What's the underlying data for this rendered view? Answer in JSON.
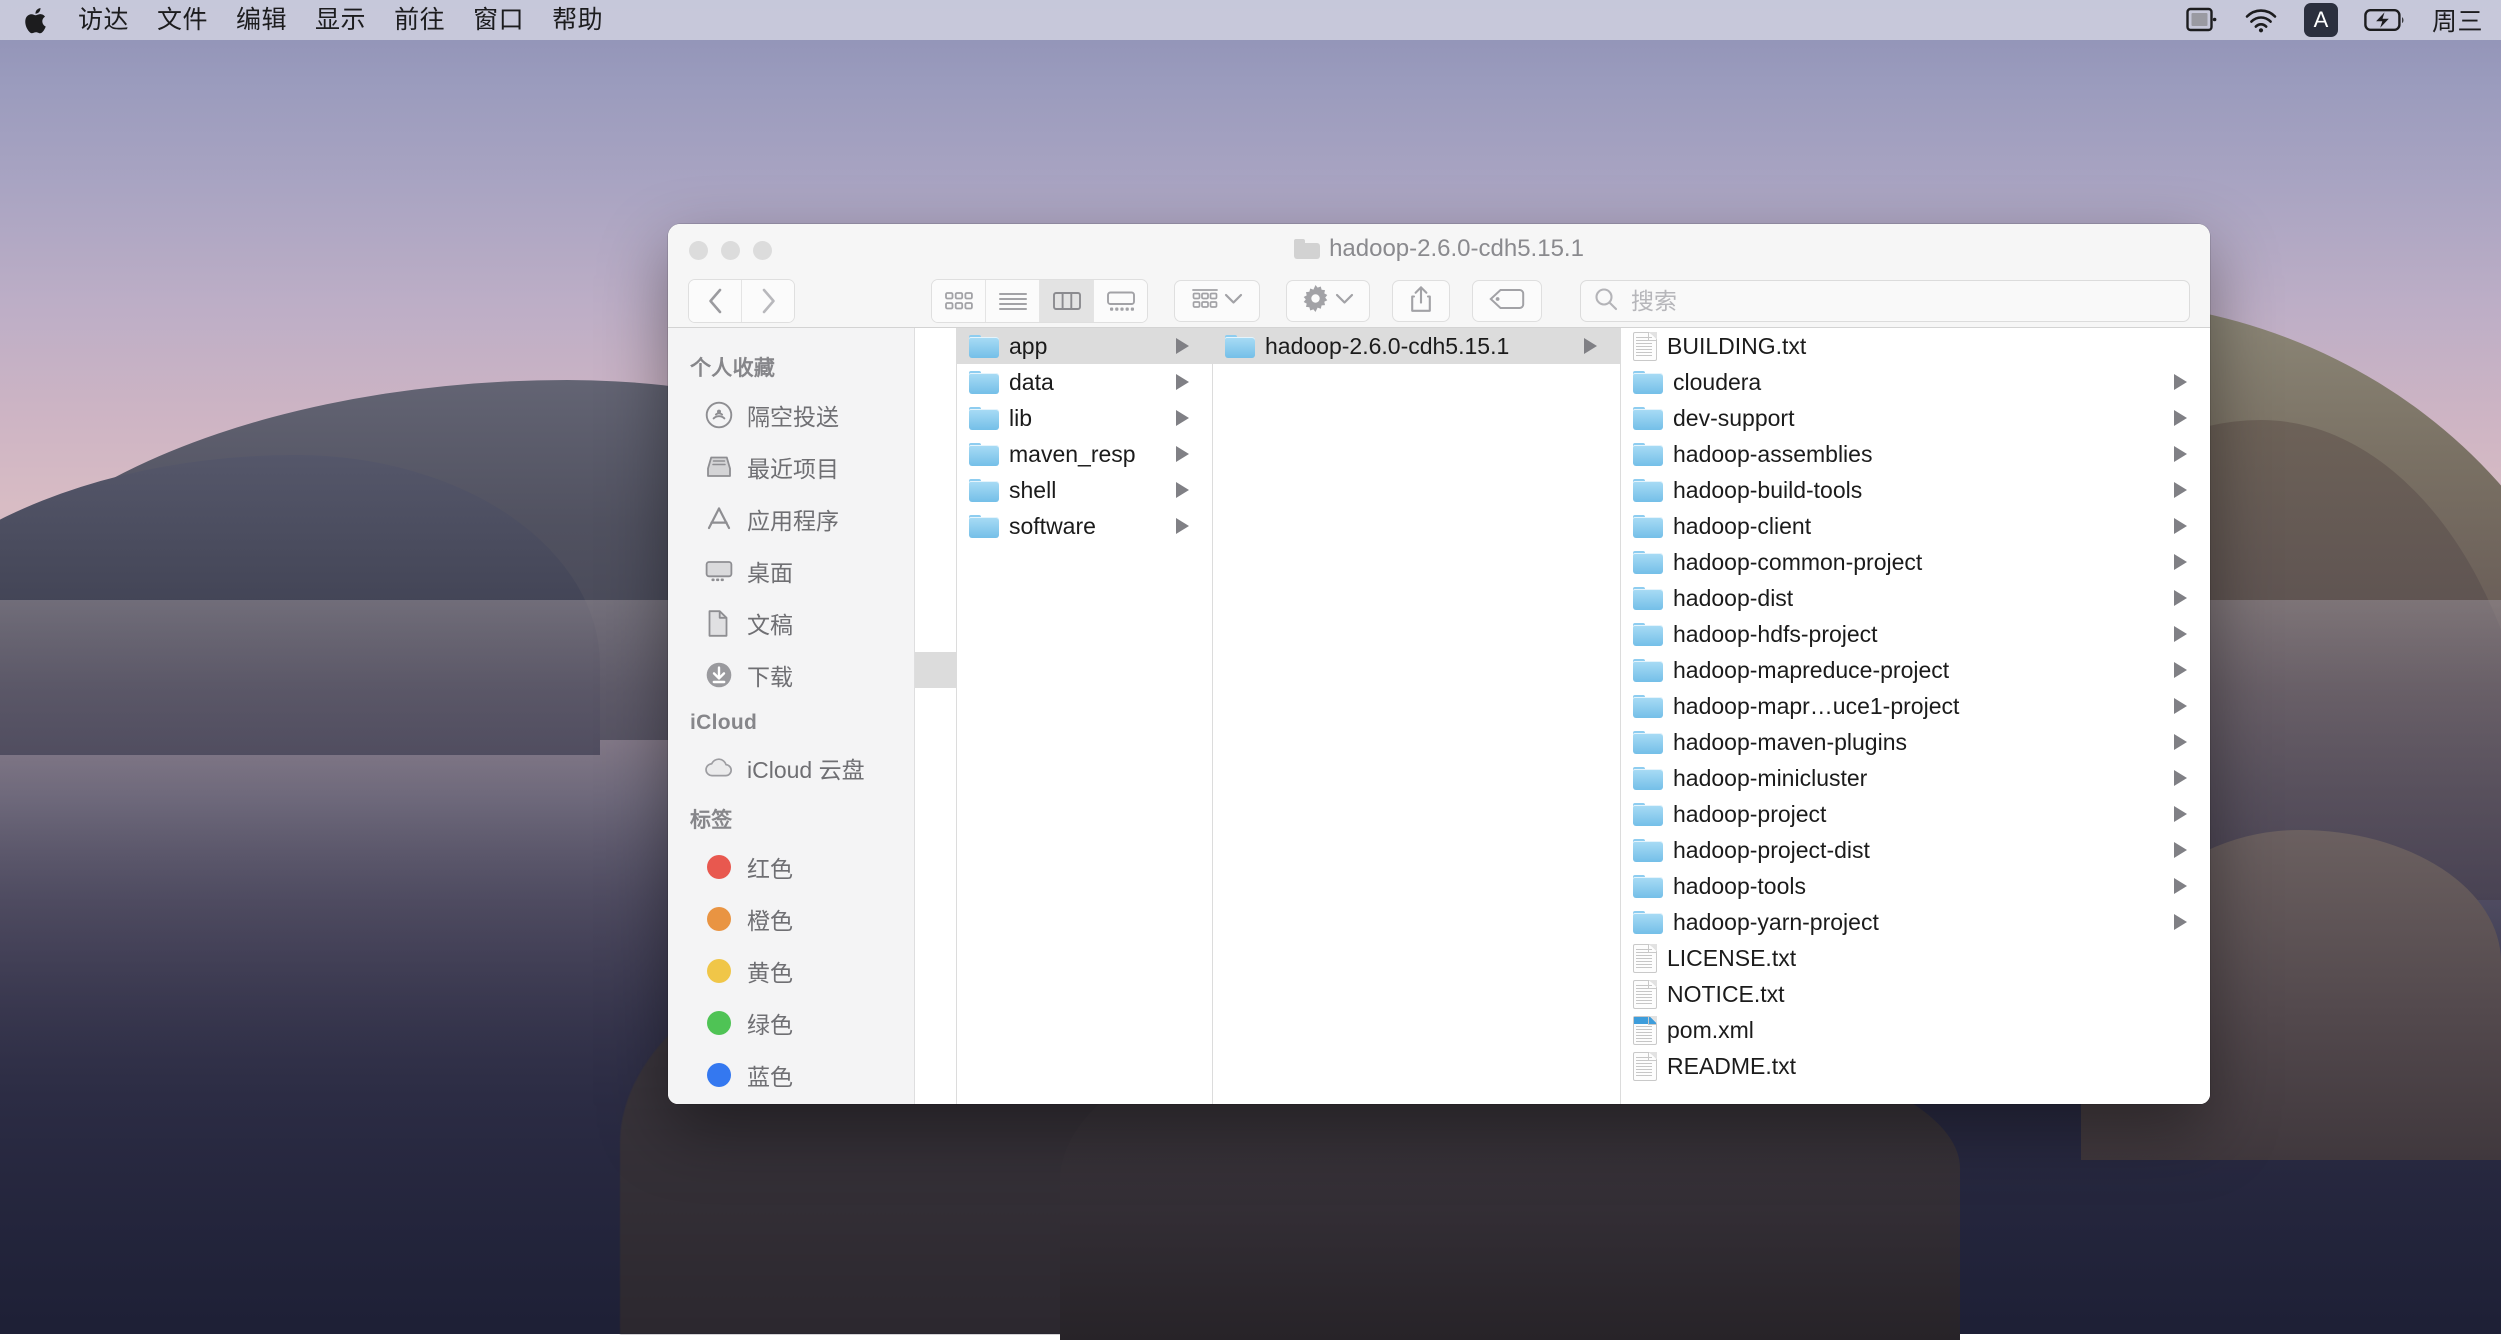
{
  "menubar": {
    "apple_icon": "apple-logo-icon",
    "items": [
      "访达",
      "文件",
      "编辑",
      "显示",
      "前往",
      "窗口",
      "帮助"
    ],
    "status_icons": [
      "screen-mirroring-icon",
      "wifi-icon",
      "input-source-badge",
      "battery-charging-icon"
    ],
    "input_source_label": "A",
    "clock": "周三"
  },
  "window": {
    "title": "hadoop-2.6.0-cdh5.15.1",
    "title_icon": "folder-icon",
    "traffic_lights": [
      "close-button",
      "minimize-button",
      "zoom-button"
    ]
  },
  "toolbar": {
    "back_icon": "chevron-left-icon",
    "forward_icon": "chevron-right-icon",
    "view_modes": [
      {
        "name": "icon-view",
        "icon": "grid-icon",
        "active": false
      },
      {
        "name": "list-view",
        "icon": "list-icon",
        "active": false
      },
      {
        "name": "column-view",
        "icon": "columns-icon",
        "active": true
      },
      {
        "name": "gallery-view",
        "icon": "gallery-icon",
        "active": false
      }
    ],
    "arrange_icon": "arrange-icon",
    "arrange_chevron": "chevron-down-icon",
    "action_icon": "gear-icon",
    "action_chevron": "chevron-down-icon",
    "share_icon": "share-icon",
    "tag_icon": "tag-icon",
    "search_placeholder": "搜索",
    "search_value": "",
    "search_icon": "search-icon"
  },
  "sidebar": {
    "sections": [
      {
        "header": "个人收藏",
        "items": [
          {
            "label": "隔空投送",
            "icon": "airdrop-icon"
          },
          {
            "label": "最近项目",
            "icon": "recents-icon"
          },
          {
            "label": "应用程序",
            "icon": "applications-icon"
          },
          {
            "label": "桌面",
            "icon": "desktop-icon"
          },
          {
            "label": "文稿",
            "icon": "documents-icon"
          },
          {
            "label": "下载",
            "icon": "downloads-icon"
          }
        ]
      },
      {
        "header": "iCloud",
        "items": [
          {
            "label": "iCloud 云盘",
            "icon": "icloud-drive-icon"
          }
        ]
      },
      {
        "header": "标签",
        "items": [
          {
            "label": "红色",
            "icon": "tag-dot-icon",
            "color": "#e8584f"
          },
          {
            "label": "橙色",
            "icon": "tag-dot-icon",
            "color": "#e99442"
          },
          {
            "label": "黄色",
            "icon": "tag-dot-icon",
            "color": "#f0c648"
          },
          {
            "label": "绿色",
            "icon": "tag-dot-icon",
            "color": "#4fc355"
          },
          {
            "label": "蓝色",
            "icon": "tag-dot-icon",
            "color": "#3478f0"
          }
        ]
      }
    ]
  },
  "columns": {
    "stub": {
      "rows": 10,
      "selected_index": 9
    },
    "col1": [
      {
        "name": "app",
        "type": "folder",
        "selected": true,
        "expandable": true
      },
      {
        "name": "data",
        "type": "folder",
        "selected": false,
        "expandable": true
      },
      {
        "name": "lib",
        "type": "folder",
        "selected": false,
        "expandable": true
      },
      {
        "name": "maven_resp",
        "type": "folder",
        "selected": false,
        "expandable": true
      },
      {
        "name": "shell",
        "type": "folder",
        "selected": false,
        "expandable": true
      },
      {
        "name": "software",
        "type": "folder",
        "selected": false,
        "expandable": true
      }
    ],
    "col2": [
      {
        "name": "hadoop-2.6.0-cdh5.15.1",
        "type": "folder",
        "selected": true,
        "expandable": true
      }
    ],
    "col3": [
      {
        "name": "BUILDING.txt",
        "type": "doc",
        "selected": false,
        "expandable": false
      },
      {
        "name": "cloudera",
        "type": "folder",
        "selected": false,
        "expandable": true
      },
      {
        "name": "dev-support",
        "type": "folder",
        "selected": false,
        "expandable": true
      },
      {
        "name": "hadoop-assemblies",
        "type": "folder",
        "selected": false,
        "expandable": true
      },
      {
        "name": "hadoop-build-tools",
        "type": "folder",
        "selected": false,
        "expandable": true
      },
      {
        "name": "hadoop-client",
        "type": "folder",
        "selected": false,
        "expandable": true
      },
      {
        "name": "hadoop-common-project",
        "type": "folder",
        "selected": false,
        "expandable": true
      },
      {
        "name": "hadoop-dist",
        "type": "folder",
        "selected": false,
        "expandable": true
      },
      {
        "name": "hadoop-hdfs-project",
        "type": "folder",
        "selected": false,
        "expandable": true
      },
      {
        "name": "hadoop-mapreduce-project",
        "type": "folder",
        "selected": false,
        "expandable": true
      },
      {
        "name": "hadoop-mapr…uce1-project",
        "type": "folder",
        "selected": false,
        "expandable": true
      },
      {
        "name": "hadoop-maven-plugins",
        "type": "folder",
        "selected": false,
        "expandable": true
      },
      {
        "name": "hadoop-minicluster",
        "type": "folder",
        "selected": false,
        "expandable": true
      },
      {
        "name": "hadoop-project",
        "type": "folder",
        "selected": false,
        "expandable": true
      },
      {
        "name": "hadoop-project-dist",
        "type": "folder",
        "selected": false,
        "expandable": true
      },
      {
        "name": "hadoop-tools",
        "type": "folder",
        "selected": false,
        "expandable": true
      },
      {
        "name": "hadoop-yarn-project",
        "type": "folder",
        "selected": false,
        "expandable": true
      },
      {
        "name": "LICENSE.txt",
        "type": "doc",
        "selected": false,
        "expandable": false
      },
      {
        "name": "NOTICE.txt",
        "type": "doc",
        "selected": false,
        "expandable": false
      },
      {
        "name": "pom.xml",
        "type": "xml",
        "selected": false,
        "expandable": false
      },
      {
        "name": "README.txt",
        "type": "doc",
        "selected": false,
        "expandable": false
      }
    ]
  }
}
